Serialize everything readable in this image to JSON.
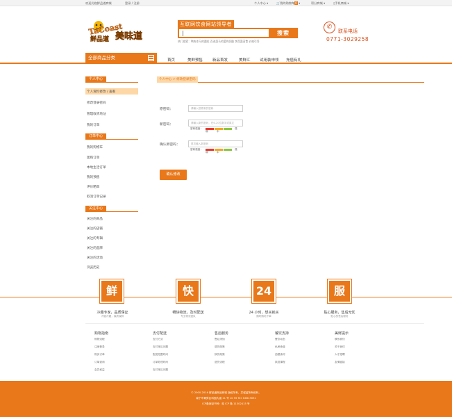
{
  "topbar": {
    "welcome": "欢迎光临鲜品道商城",
    "login": "登录 / 注册",
    "personal": "个人中心",
    "cart": "我的购物车",
    "cart_count": "0",
    "points": "积分商城",
    "mobile": "手机商城"
  },
  "header": {
    "logo_text_1": "TaCoast",
    "logo_text_2": "美味道",
    "slogan": "互联网饮食网站领导者",
    "search_placeholder": "",
    "search_button": "搜索",
    "hotwords": "热门搜索：鸭肉本马的圆拉  百进惠马的爱的奶酪  李西惠田食  价格引导",
    "phone_label": "联系电话",
    "phone_number": "0771-3029258"
  },
  "nav": {
    "category_button": "全部商品分类",
    "items": [
      "首页",
      "美鲜预售",
      "新品首发",
      "美鲜汇",
      "试用装申领",
      "充值有礼"
    ]
  },
  "sidebar": {
    "sections": [
      {
        "title": "个人中心",
        "items": [
          "个人资料修改 / 查看",
          "修改登录密码",
          "管理收货地址",
          "我的订单"
        ]
      },
      {
        "title": "订单中心",
        "items": [
          "我的购物车",
          "团购订单",
          "本地生活订单",
          "我的预售",
          "评价晒单",
          "取消订单记录"
        ]
      },
      {
        "title": "关注中心",
        "items": [
          "关注的商品",
          "关注的店铺",
          "关注的专辑",
          "关注的品牌",
          "关注的活动",
          "浏览历史"
        ]
      }
    ]
  },
  "main": {
    "breadcrumb": "个人中心 > 修改登录密码",
    "old_password_label": "原密码：",
    "old_password_placeholder": "请输入您原来的密码",
    "new_password_label": "新密码：",
    "new_password_placeholder": "请输入新的密码，在6-20位数字或英文",
    "strength_label": "密码强度：",
    "strength_weak": "弱",
    "strength_mid": "中",
    "strength_strong": "强",
    "confirm_password_label": "确认新密码：",
    "confirm_password_placeholder": "再次输入新密码",
    "confirm_button": "确认修改",
    "strength_colors": [
      "#e83a2f",
      "#f5a623",
      "#8cc63f"
    ]
  },
  "features": [
    {
      "icon": "鲜",
      "title": "冷藏专家，品质保证",
      "sub": "冷链冷藏，保质保鲜"
    },
    {
      "icon": "快",
      "title": "畅快物流，及时配送",
      "sub": "专业物流团队"
    },
    {
      "icon": "24",
      "title": "24 小时，想买就买",
      "sub": "随时随地下单"
    },
    {
      "icon": "服",
      "title": "贴心服务，售后无忧",
      "sub": "贴心的售后服务"
    }
  ],
  "footer_columns": [
    {
      "title": "购物指南",
      "items": [
        "购物流程",
        "注册登录",
        "购买订单",
        "订单查询",
        "会员权益"
      ]
    },
    {
      "title": "支付配送",
      "items": [
        "支付方式",
        "支付常见问题",
        "配送范围时间",
        "订单处理时间",
        "支付常见问题"
      ]
    },
    {
      "title": "售后服务",
      "items": [
        "售后须知",
        "退货政策",
        "换货政策",
        "退货流程"
      ]
    },
    {
      "title": "餐饮支持",
      "items": [
        "餐饮动态",
        "私房食谱",
        "西餐食材",
        "烘焙课程"
      ]
    },
    {
      "title": "美鲜提示",
      "items": [
        "联系我们",
        "关于我们",
        "人才招聘",
        "友情链接"
      ]
    }
  ],
  "footer": {
    "line1": "© 2000-2016 鲜品道商品商城 版权所有，并保留所有权利。",
    "line2": "南宁市青秀区科园大道 11 号 10 55 Tel: 64613031",
    "line3": "ICP备案证书号：桂 ICP 备 11302415 号"
  }
}
